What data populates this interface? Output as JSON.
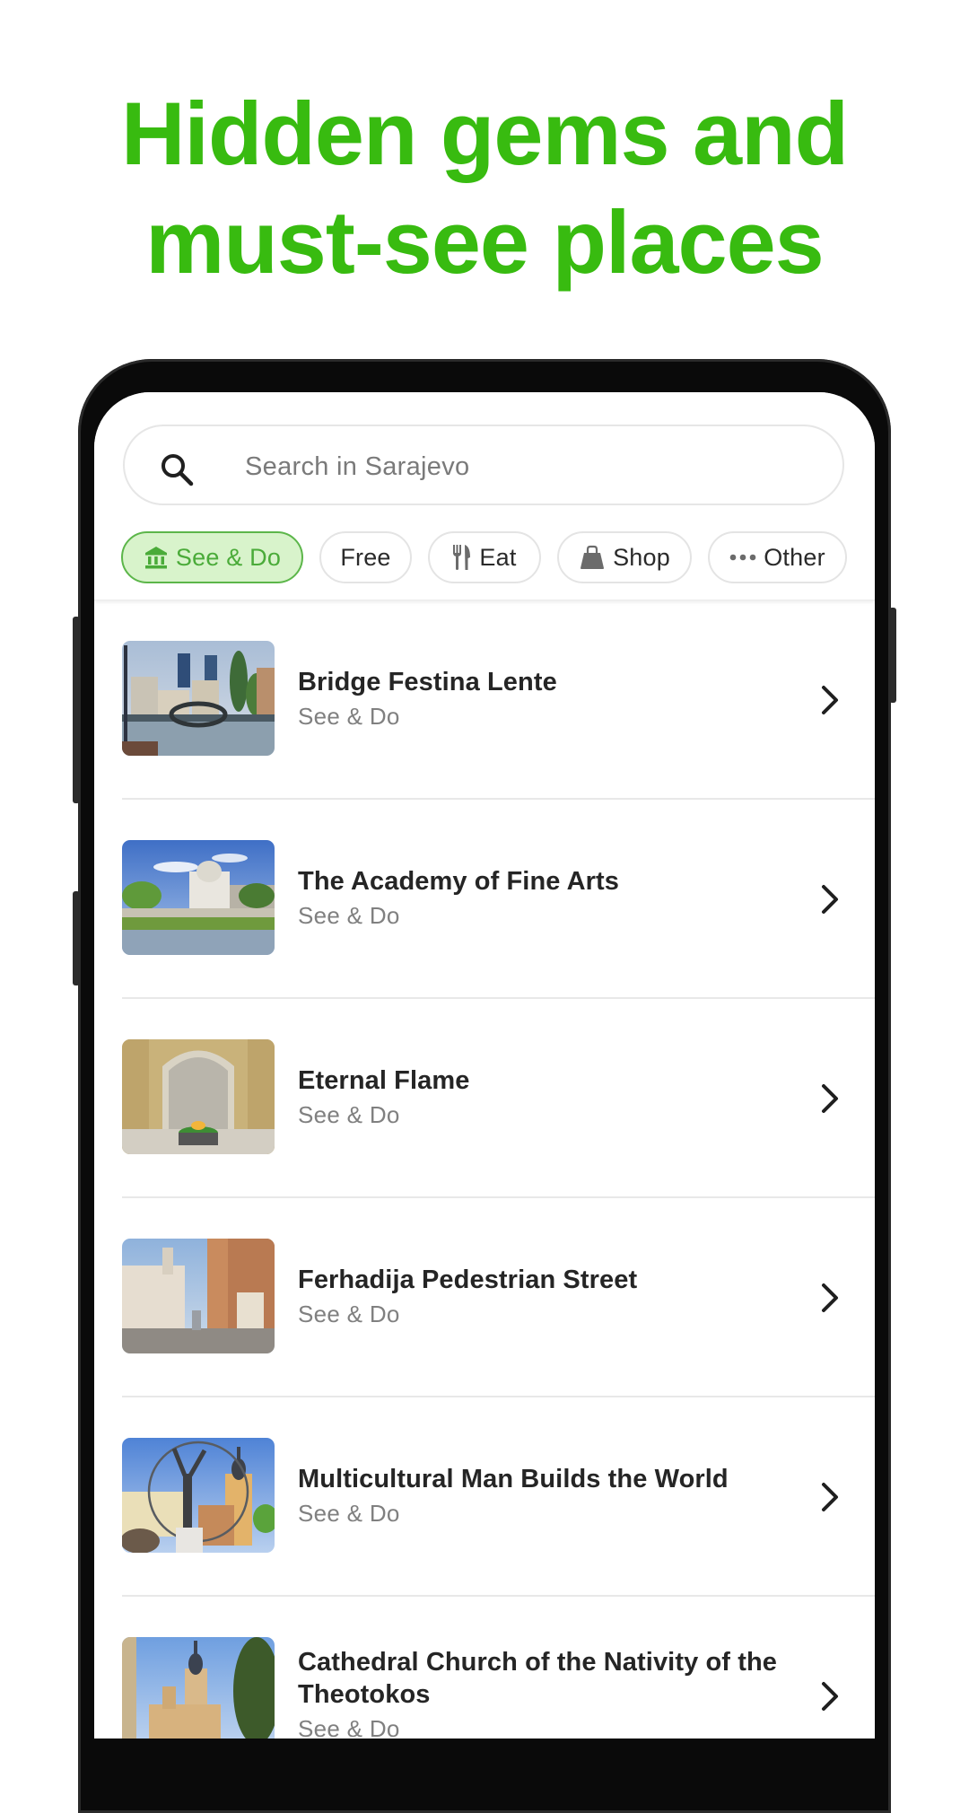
{
  "headline": {
    "line1": "Hidden gems and",
    "line2": "must-see places",
    "color": "#38bb10"
  },
  "search": {
    "placeholder": "Search in Sarajevo",
    "icon": "search-icon"
  },
  "filters": [
    {
      "label": "See & Do",
      "icon": "museum-icon",
      "active": true
    },
    {
      "label": "Free",
      "icon": null,
      "active": false
    },
    {
      "label": "Eat",
      "icon": "fork-knife-icon",
      "active": false
    },
    {
      "label": "Shop",
      "icon": "shopping-bag-icon",
      "active": false
    },
    {
      "label": "Other",
      "icon": "more-dots-icon",
      "active": false
    }
  ],
  "places": [
    {
      "title": "Bridge Festina Lente",
      "category": "See & Do"
    },
    {
      "title": "The Academy of Fine Arts",
      "category": "See & Do"
    },
    {
      "title": "Eternal Flame",
      "category": "See & Do"
    },
    {
      "title": "Ferhadija Pedestrian Street",
      "category": "See & Do"
    },
    {
      "title": "Multicultural Man Builds the World",
      "category": "See & Do"
    },
    {
      "title": "Cathedral Church of the Nativity of the Theotokos",
      "category": "See & Do"
    }
  ],
  "colors": {
    "accent": "#38bb10",
    "chip_active_bg": "#d8f3cb",
    "chip_active_border": "#5cb64a",
    "chip_active_text": "#4aab39"
  }
}
